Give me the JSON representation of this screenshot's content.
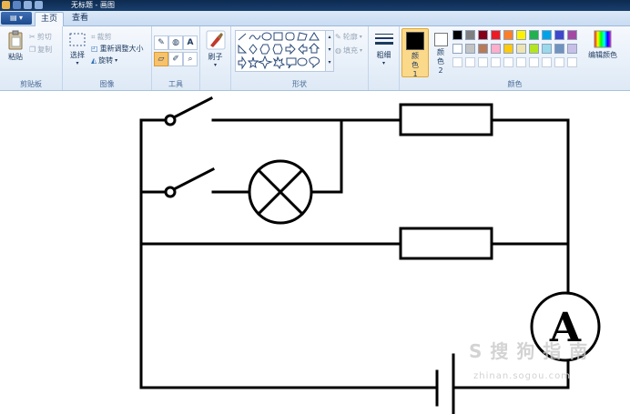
{
  "window": {
    "title": "无标题 - 画图"
  },
  "tabs": {
    "app_menu": "▤ ▾",
    "home": "主页",
    "view": "查看"
  },
  "clipboard": {
    "paste": "粘贴",
    "cut": "剪切",
    "copy": "复制",
    "group": "剪贴板"
  },
  "image": {
    "select": "选择",
    "crop": "裁剪",
    "resize": "重新调整大小",
    "rotate": "旋转",
    "group": "图像"
  },
  "tools": {
    "text_tool": "A",
    "group": "工具"
  },
  "brushes": {
    "label": "刷子"
  },
  "shapes": {
    "outline": "轮廓",
    "fill": "填充",
    "group": "形状"
  },
  "size": {
    "label": "粗细"
  },
  "colors": {
    "color1": "颜色 1",
    "color2": "颜色 2",
    "edit": "编辑颜色",
    "group": "颜色",
    "color1_value": "#000000",
    "color2_value": "#ffffff",
    "palette_row1": [
      "#000000",
      "#7f7f7f",
      "#880015",
      "#ed1c24",
      "#ff7f27",
      "#fff200",
      "#22b14c",
      "#00a2e8",
      "#3f48cc",
      "#a349a4"
    ],
    "palette_row2": [
      "#ffffff",
      "#c3c3c3",
      "#b97a57",
      "#ffaec9",
      "#ffc90e",
      "#efe4b0",
      "#b5e61d",
      "#99d9ea",
      "#7092be",
      "#c8bfe7"
    ]
  },
  "canvas": {
    "ammeter_label": "A"
  },
  "watermark": {
    "text": "S 搜 狗 指 南",
    "url": "zhinan.sogou.com"
  }
}
